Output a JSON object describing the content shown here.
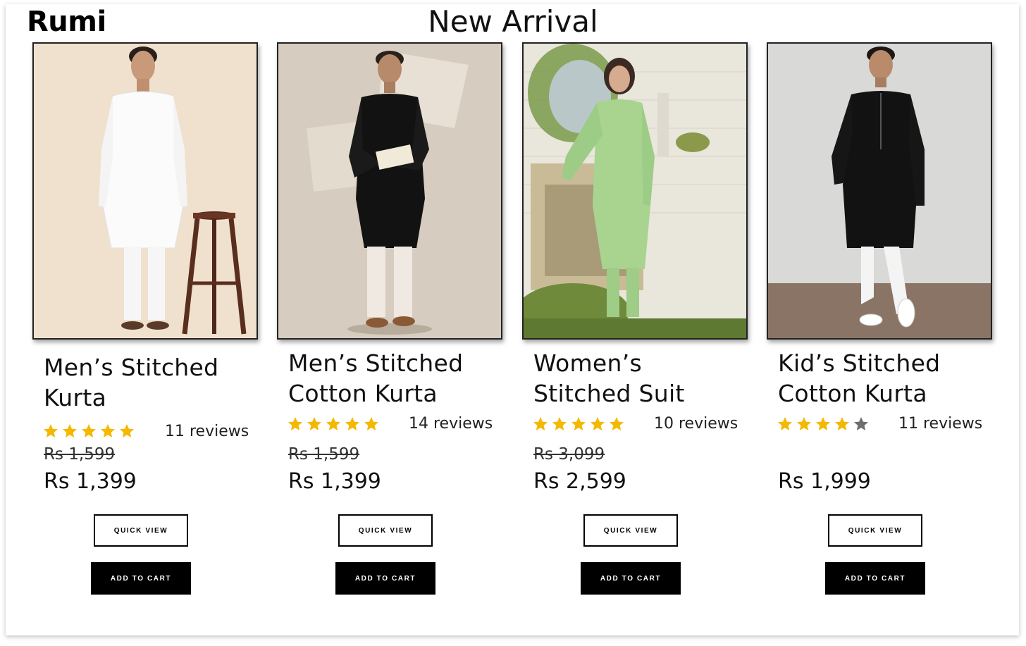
{
  "brand": "Rumi",
  "page_title": "New Arrival",
  "colors": {
    "star_filled": "#f5b800",
    "star_empty": "#6e6e6e",
    "button_dark": "#000000"
  },
  "products": [
    {
      "name_line1": "Men’s Stitched",
      "name_line2": "Kurta",
      "rating": 5,
      "reviews": "11 reviews",
      "old_price": "Rs 1,599",
      "price": "Rs 1,399",
      "quick_view": "QUICK VIEW",
      "add_to_cart": "ADD TO CART"
    },
    {
      "name_line1": "Men’s Stitched",
      "name_line2": "Cotton Kurta",
      "rating": 5,
      "reviews": "14 reviews",
      "old_price": "Rs 1,599",
      "price": "Rs 1,399",
      "quick_view": "QUICK VIEW",
      "add_to_cart": "ADD TO CART"
    },
    {
      "name_line1": "Women’s",
      "name_line2": "Stitched Suit",
      "rating": 5,
      "reviews": "10 reviews",
      "old_price": "Rs 3,099",
      "price": "Rs 2,599",
      "quick_view": "QUICK VIEW",
      "add_to_cart": "ADD TO CART"
    },
    {
      "name_line1": "Kid’s Stitched",
      "name_line2": "Cotton Kurta",
      "rating": 4,
      "reviews": "11 reviews",
      "old_price": "",
      "price": "Rs 1,999",
      "quick_view": "QUICK VIEW",
      "add_to_cart": "ADD TO CART"
    }
  ]
}
